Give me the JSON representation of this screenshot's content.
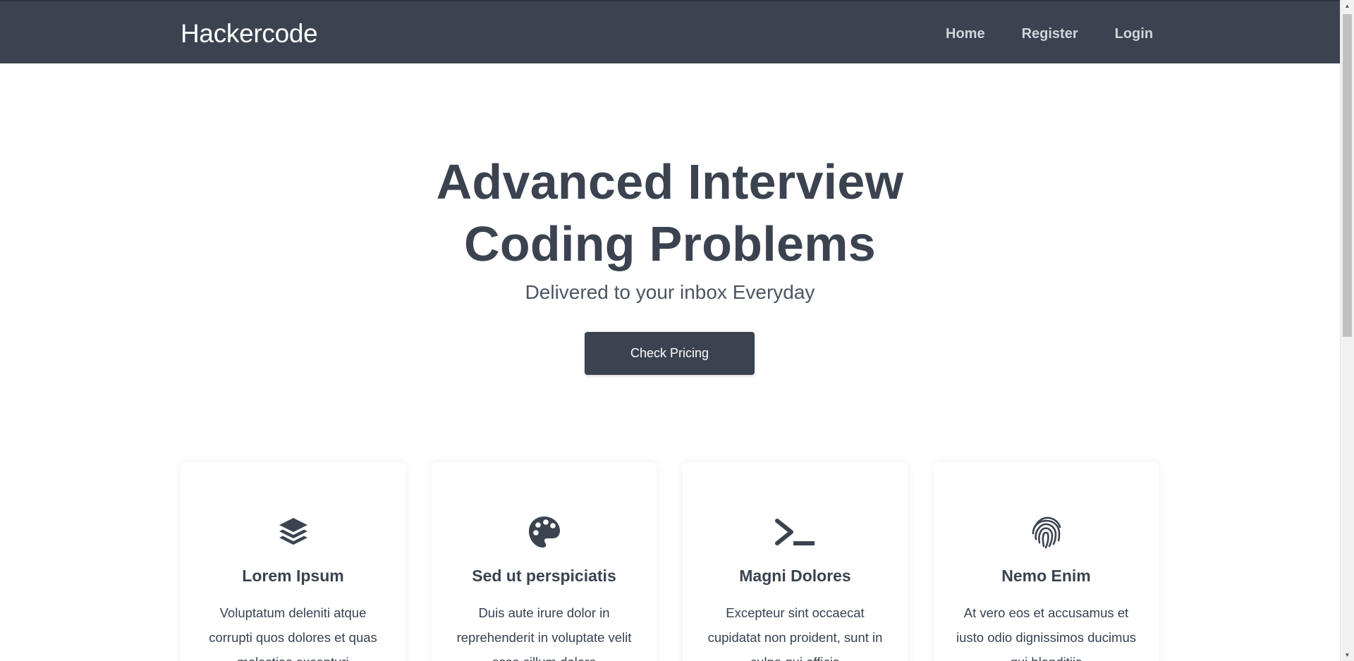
{
  "navbar": {
    "brand": "Hackercode",
    "links": [
      "Home",
      "Register",
      "Login"
    ]
  },
  "hero": {
    "title_line1": "Advanced Interview",
    "title_line2": "Coding Problems",
    "subtitle": "Delivered to your inbox Everyday",
    "cta_label": "Check Pricing"
  },
  "features": [
    {
      "icon": "layers-icon",
      "title": "Lorem Ipsum",
      "text": "Voluptatum deleniti atque corrupti quos dolores et quas molestias excepturi"
    },
    {
      "icon": "palette-icon",
      "title": "Sed ut perspiciatis",
      "text": "Duis aute irure dolor in reprehenderit in voluptate velit esse cillum dolore"
    },
    {
      "icon": "terminal-icon",
      "title": "Magni Dolores",
      "text": "Excepteur sint occaecat cupidatat non proident, sunt in culpa qui officia"
    },
    {
      "icon": "fingerprint-icon",
      "title": "Nemo Enim",
      "text": "At vero eos et accusamus et iusto odio dignissimos ducimus qui blanditiis"
    }
  ],
  "colors": {
    "navbar_bg": "#3b4350",
    "primary_text": "#3b4350",
    "nav_link": "#d1d5db",
    "button_bg": "#3b4350",
    "button_text": "#ffffff"
  }
}
